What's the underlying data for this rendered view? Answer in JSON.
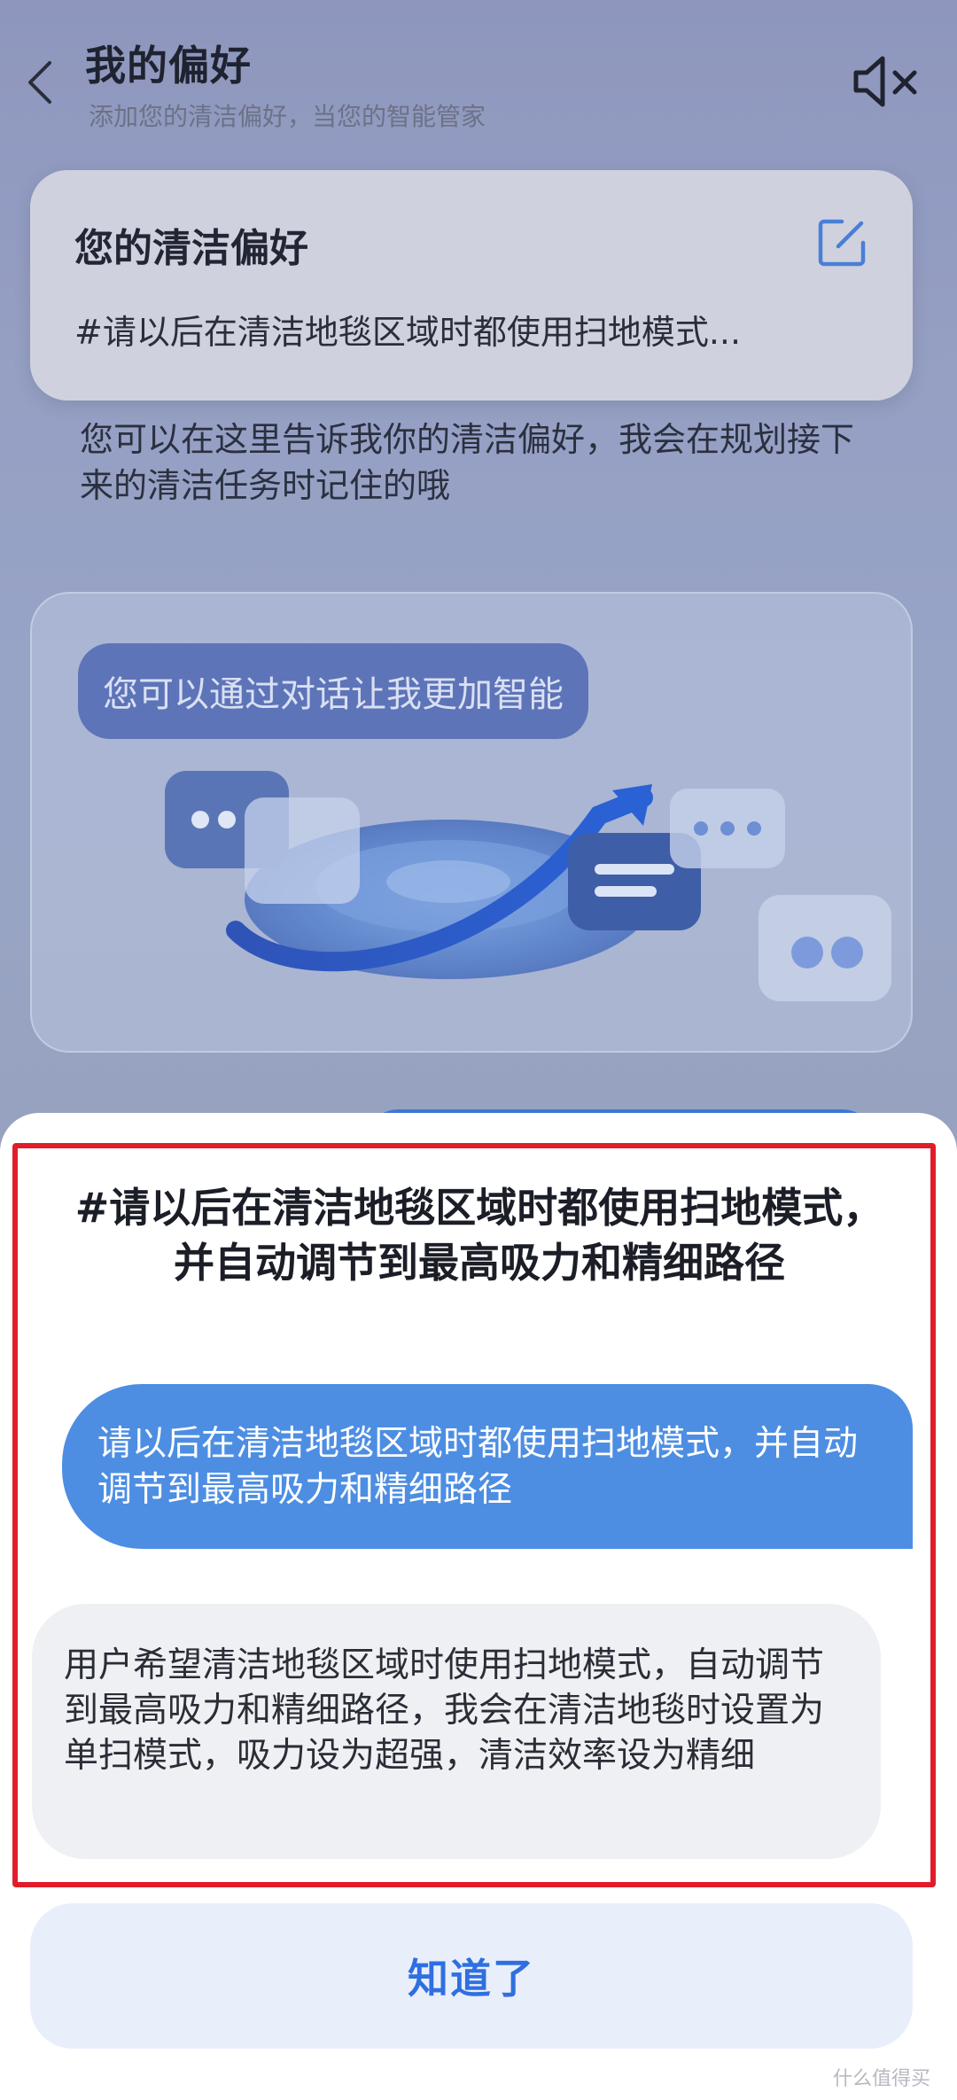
{
  "header": {
    "title": "我的偏好",
    "subtitle": "添加您的清洁偏好，当您的智能管家"
  },
  "preference_card": {
    "title": "您的清洁偏好",
    "text": "#请以后在清洁地毯区域时都使用扫地模式..."
  },
  "description": "您可以在这里告诉我你的清洁偏好，我会在规划接下来的清洁任务时记住的哦",
  "illustration": {
    "bubble_text": "您可以通过对话让我更加智能"
  },
  "sheet": {
    "title_line1": "#请以后在清洁地毯区域时都使用扫地模式，",
    "title_line2": "并自动调节到最高吸力和精细路径",
    "user_message": "请以后在清洁地毯区域时都使用扫地模式，并自动调节到最高吸力和精细路径",
    "assistant_reply": "用户希望清洁地毯区域时使用扫地模式，自动调节到最高吸力和精细路径，我会在清洁地毯时设置为单扫模式，吸力设为超强，清洁效率设为精细",
    "confirm_label": "知道了"
  },
  "watermark": "什么值得买",
  "icons": {
    "back": "chevron-left-icon",
    "mute": "speaker-muted-icon",
    "edit": "edit-icon"
  },
  "colors": {
    "accent": "#2f6fe0",
    "user_bubble": "#4d8ee3",
    "highlight": "#e11d2a"
  }
}
